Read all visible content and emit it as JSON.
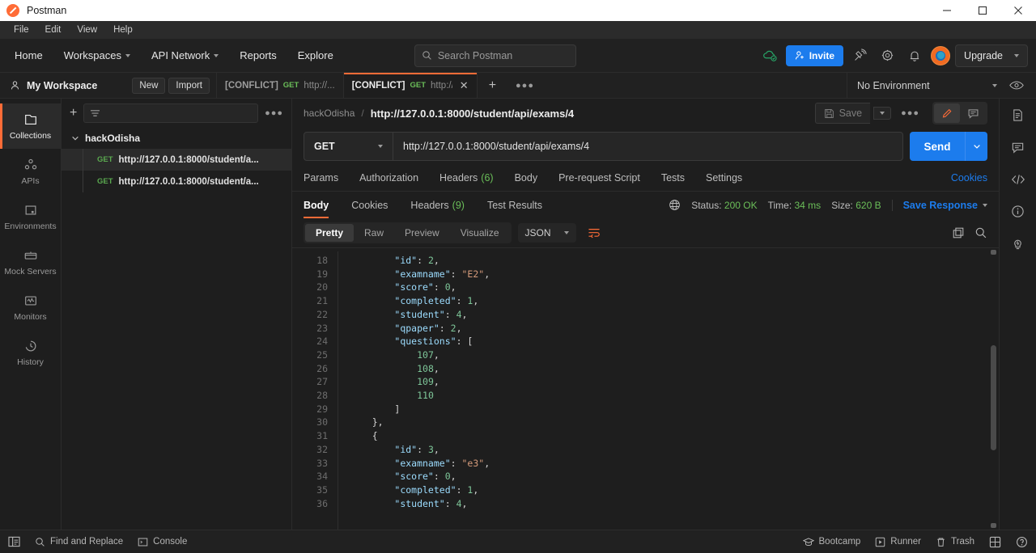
{
  "titlebar": {
    "app_title": "Postman"
  },
  "menubar": {
    "items": [
      {
        "label": "File"
      },
      {
        "label": "Edit"
      },
      {
        "label": "View"
      },
      {
        "label": "Help"
      }
    ]
  },
  "header": {
    "nav": [
      {
        "label": "Home",
        "caret": false
      },
      {
        "label": "Workspaces",
        "caret": true
      },
      {
        "label": "API Network",
        "caret": true
      },
      {
        "label": "Reports",
        "caret": false
      },
      {
        "label": "Explore",
        "caret": false
      }
    ],
    "search_placeholder": "Search Postman",
    "invite_label": "Invite",
    "upgrade_label": "Upgrade",
    "icons": [
      "cloud-sync-icon",
      "satellite-icon",
      "gear-icon",
      "bell-icon",
      "avatar"
    ]
  },
  "workspace": {
    "name": "My Workspace",
    "new_label": "New",
    "import_label": "Import",
    "environment_label": "No Environment"
  },
  "tabs": [
    {
      "conflict": "[CONFLICT]",
      "method": "GET",
      "url": "http://...",
      "active": false
    },
    {
      "conflict": "[CONFLICT]",
      "method": "GET",
      "url": "http://...",
      "active": true
    }
  ],
  "sidebar_rail": [
    {
      "label": "Collections",
      "icon": "collections-icon",
      "active": true
    },
    {
      "label": "APIs",
      "icon": "apis-icon",
      "active": false
    },
    {
      "label": "Environments",
      "icon": "environments-icon",
      "active": false
    },
    {
      "label": "Mock Servers",
      "icon": "mock-servers-icon",
      "active": false
    },
    {
      "label": "Monitors",
      "icon": "monitors-icon",
      "active": false
    },
    {
      "label": "History",
      "icon": "history-icon",
      "active": false
    }
  ],
  "collections_panel": {
    "collection_name": "hackOdisha",
    "requests": [
      {
        "method": "GET",
        "name": "http://127.0.0.1:8000/student/a...",
        "selected": true
      },
      {
        "method": "GET",
        "name": "http://127.0.0.1:8000/student/a...",
        "selected": false
      }
    ]
  },
  "request": {
    "breadcrumb_collection": "hackOdisha",
    "breadcrumb_separator": "/",
    "breadcrumb_name": "http://127.0.0.1:8000/student/api/exams/4",
    "save_label": "Save",
    "method": "GET",
    "url": "http://127.0.0.1:8000/student/api/exams/4",
    "send_label": "Send",
    "tabs": [
      {
        "label": "Params",
        "count": null
      },
      {
        "label": "Authorization",
        "count": null
      },
      {
        "label": "Headers",
        "count": "(6)"
      },
      {
        "label": "Body",
        "count": null
      },
      {
        "label": "Pre-request Script",
        "count": null
      },
      {
        "label": "Tests",
        "count": null
      },
      {
        "label": "Settings",
        "count": null
      }
    ],
    "cookies_link": "Cookies"
  },
  "response": {
    "tabs": [
      {
        "label": "Body",
        "count": null,
        "active": true
      },
      {
        "label": "Cookies",
        "count": null,
        "active": false
      },
      {
        "label": "Headers",
        "count": "(9)",
        "active": false
      },
      {
        "label": "Test Results",
        "count": null,
        "active": false
      }
    ],
    "status_label": "Status:",
    "status_value": "200 OK",
    "time_label": "Time:",
    "time_value": "34 ms",
    "size_label": "Size:",
    "size_value": "620 B",
    "save_response_label": "Save Response",
    "view_modes": [
      {
        "label": "Pretty",
        "active": true
      },
      {
        "label": "Raw",
        "active": false
      },
      {
        "label": "Preview",
        "active": false
      },
      {
        "label": "Visualize",
        "active": false
      }
    ],
    "format": "JSON",
    "code_lines": [
      {
        "n": 18,
        "indent": 8,
        "tokens": [
          {
            "t": "k",
            "v": "\"id\""
          },
          {
            "t": "p",
            "v": ": "
          },
          {
            "t": "n",
            "v": "2"
          },
          {
            "t": "p",
            "v": ","
          }
        ]
      },
      {
        "n": 19,
        "indent": 8,
        "tokens": [
          {
            "t": "k",
            "v": "\"examname\""
          },
          {
            "t": "p",
            "v": ": "
          },
          {
            "t": "s",
            "v": "\"E2\""
          },
          {
            "t": "p",
            "v": ","
          }
        ]
      },
      {
        "n": 20,
        "indent": 8,
        "tokens": [
          {
            "t": "k",
            "v": "\"score\""
          },
          {
            "t": "p",
            "v": ": "
          },
          {
            "t": "n",
            "v": "0"
          },
          {
            "t": "p",
            "v": ","
          }
        ]
      },
      {
        "n": 21,
        "indent": 8,
        "tokens": [
          {
            "t": "k",
            "v": "\"completed\""
          },
          {
            "t": "p",
            "v": ": "
          },
          {
            "t": "n",
            "v": "1"
          },
          {
            "t": "p",
            "v": ","
          }
        ]
      },
      {
        "n": 22,
        "indent": 8,
        "tokens": [
          {
            "t": "k",
            "v": "\"student\""
          },
          {
            "t": "p",
            "v": ": "
          },
          {
            "t": "n",
            "v": "4"
          },
          {
            "t": "p",
            "v": ","
          }
        ]
      },
      {
        "n": 23,
        "indent": 8,
        "tokens": [
          {
            "t": "k",
            "v": "\"qpaper\""
          },
          {
            "t": "p",
            "v": ": "
          },
          {
            "t": "n",
            "v": "2"
          },
          {
            "t": "p",
            "v": ","
          }
        ]
      },
      {
        "n": 24,
        "indent": 8,
        "tokens": [
          {
            "t": "k",
            "v": "\"questions\""
          },
          {
            "t": "p",
            "v": ": "
          },
          {
            "t": "b",
            "v": "["
          }
        ]
      },
      {
        "n": 25,
        "indent": 12,
        "tokens": [
          {
            "t": "n",
            "v": "107"
          },
          {
            "t": "p",
            "v": ","
          }
        ]
      },
      {
        "n": 26,
        "indent": 12,
        "tokens": [
          {
            "t": "n",
            "v": "108"
          },
          {
            "t": "p",
            "v": ","
          }
        ]
      },
      {
        "n": 27,
        "indent": 12,
        "tokens": [
          {
            "t": "n",
            "v": "109"
          },
          {
            "t": "p",
            "v": ","
          }
        ]
      },
      {
        "n": 28,
        "indent": 12,
        "tokens": [
          {
            "t": "n",
            "v": "110"
          }
        ]
      },
      {
        "n": 29,
        "indent": 8,
        "tokens": [
          {
            "t": "b",
            "v": "]"
          }
        ]
      },
      {
        "n": 30,
        "indent": 4,
        "tokens": [
          {
            "t": "b",
            "v": "},"
          }
        ]
      },
      {
        "n": 31,
        "indent": 4,
        "tokens": [
          {
            "t": "b",
            "v": "{"
          }
        ]
      },
      {
        "n": 32,
        "indent": 8,
        "tokens": [
          {
            "t": "k",
            "v": "\"id\""
          },
          {
            "t": "p",
            "v": ": "
          },
          {
            "t": "n",
            "v": "3"
          },
          {
            "t": "p",
            "v": ","
          }
        ]
      },
      {
        "n": 33,
        "indent": 8,
        "tokens": [
          {
            "t": "k",
            "v": "\"examname\""
          },
          {
            "t": "p",
            "v": ": "
          },
          {
            "t": "s",
            "v": "\"e3\""
          },
          {
            "t": "p",
            "v": ","
          }
        ]
      },
      {
        "n": 34,
        "indent": 8,
        "tokens": [
          {
            "t": "k",
            "v": "\"score\""
          },
          {
            "t": "p",
            "v": ": "
          },
          {
            "t": "n",
            "v": "0"
          },
          {
            "t": "p",
            "v": ","
          }
        ]
      },
      {
        "n": 35,
        "indent": 8,
        "tokens": [
          {
            "t": "k",
            "v": "\"completed\""
          },
          {
            "t": "p",
            "v": ": "
          },
          {
            "t": "n",
            "v": "1"
          },
          {
            "t": "p",
            "v": ","
          }
        ]
      },
      {
        "n": 36,
        "indent": 8,
        "tokens": [
          {
            "t": "k",
            "v": "\"student\""
          },
          {
            "t": "p",
            "v": ": "
          },
          {
            "t": "n",
            "v": "4"
          },
          {
            "t": "p",
            "v": ","
          }
        ]
      }
    ]
  },
  "statusbar": {
    "left": [
      {
        "label": "Find and Replace",
        "icon": "search-icon"
      },
      {
        "label": "Console",
        "icon": "console-icon"
      }
    ],
    "right": [
      {
        "label": "Bootcamp",
        "icon": "bootcamp-icon"
      },
      {
        "label": "Runner",
        "icon": "runner-icon"
      },
      {
        "label": "Trash",
        "icon": "trash-icon"
      }
    ]
  },
  "right_rail": [
    "document-icon",
    "comment-icon",
    "code-icon",
    "info-icon",
    "bulb-icon"
  ],
  "colors": {
    "accent": "#ff6c37",
    "blue": "#1c7ced",
    "green": "#6bbf59",
    "bg": "#1e1e1e",
    "panel": "#212121"
  }
}
